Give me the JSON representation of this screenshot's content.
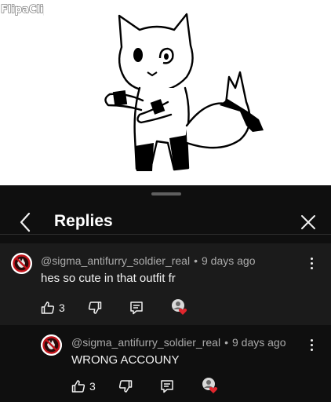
{
  "video": {
    "watermark_text": "FlipaClip",
    "icon": "cartoon-cat-drawing"
  },
  "sheet": {
    "title": "Replies",
    "back_icon": "chevron-left-icon",
    "close_icon": "close-icon"
  },
  "comments": [
    {
      "author": "@sigma_antifurry_soldier_real",
      "time": "9 days ago",
      "text": "hes so cute in that outfit fr",
      "likes": "3",
      "avatar": "no-furry-symbol-avatar"
    },
    {
      "author": "@sigma_antifurry_soldier_real",
      "time": "9 days ago",
      "text": "WRONG ACCOUNY",
      "likes": "3",
      "avatar": "no-furry-symbol-avatar"
    }
  ],
  "colors": {
    "background": "#0f0f0f",
    "highlight_row": "#1b1b1b",
    "secondary_text": "#aaaaaa",
    "heart": "#e1262d"
  }
}
